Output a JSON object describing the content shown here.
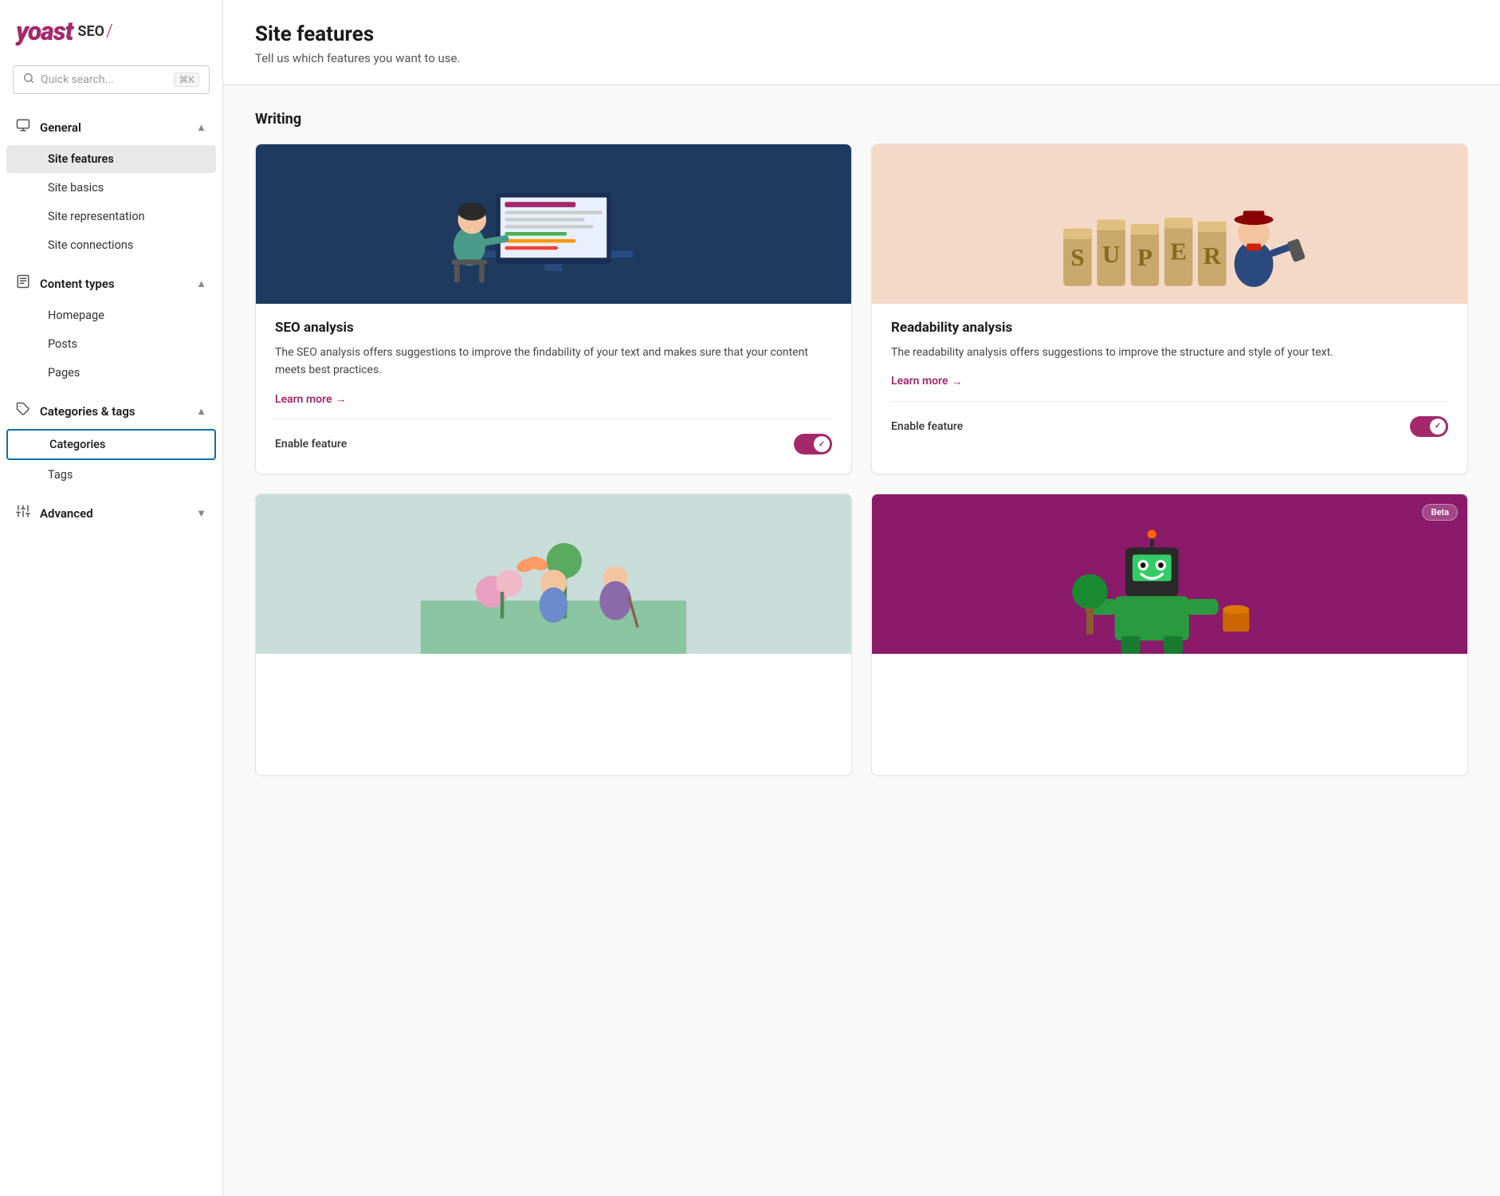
{
  "logo": {
    "yoast": "yoast",
    "seo": "SEO",
    "slash": "/"
  },
  "search": {
    "placeholder": "Quick search...",
    "shortcut": "⌘K"
  },
  "sidebar": {
    "sections": [
      {
        "id": "general",
        "icon": "monitor-icon",
        "title": "General",
        "expanded": true,
        "items": [
          {
            "id": "site-features",
            "label": "Site features",
            "active": true,
            "selected": false
          },
          {
            "id": "site-basics",
            "label": "Site basics",
            "active": false,
            "selected": false
          },
          {
            "id": "site-representation",
            "label": "Site representation",
            "active": false,
            "selected": false
          },
          {
            "id": "site-connections",
            "label": "Site connections",
            "active": false,
            "selected": false
          }
        ]
      },
      {
        "id": "content-types",
        "icon": "document-icon",
        "title": "Content types",
        "expanded": true,
        "items": [
          {
            "id": "homepage",
            "label": "Homepage",
            "active": false,
            "selected": false
          },
          {
            "id": "posts",
            "label": "Posts",
            "active": false,
            "selected": false
          },
          {
            "id": "pages",
            "label": "Pages",
            "active": false,
            "selected": false
          }
        ]
      },
      {
        "id": "categories-tags",
        "icon": "tag-icon",
        "title": "Categories & tags",
        "expanded": true,
        "items": [
          {
            "id": "categories",
            "label": "Categories",
            "active": false,
            "selected": true
          },
          {
            "id": "tags",
            "label": "Tags",
            "active": false,
            "selected": false
          }
        ]
      },
      {
        "id": "advanced",
        "icon": "sliders-icon",
        "title": "Advanced",
        "expanded": false,
        "items": []
      }
    ]
  },
  "page": {
    "title": "Site features",
    "subtitle": "Tell us which features you want to use."
  },
  "writing_section": {
    "title": "Writing",
    "cards": [
      {
        "id": "seo-analysis",
        "title": "SEO analysis",
        "description": "The SEO analysis offers suggestions to improve the findability of your text and makes sure that your content meets best practices.",
        "learn_more": "Learn more",
        "learn_more_arrow": "→",
        "enable_label": "Enable feature",
        "enabled": true,
        "illustration": "seo",
        "beta": false
      },
      {
        "id": "readability-analysis",
        "title": "Readability analysis",
        "description": "The readability analysis offers suggestions to improve the structure and style of your text.",
        "learn_more": "Learn more",
        "learn_more_arrow": "→",
        "enable_label": "Enable feature",
        "enabled": true,
        "illustration": "readability",
        "beta": false
      },
      {
        "id": "third-feature",
        "title": "",
        "description": "",
        "learn_more": "",
        "enable_label": "",
        "enabled": false,
        "illustration": "third",
        "beta": false
      },
      {
        "id": "fourth-feature",
        "title": "",
        "description": "",
        "learn_more": "",
        "enable_label": "",
        "enabled": false,
        "illustration": "fourth",
        "beta": true,
        "beta_label": "Beta"
      }
    ]
  }
}
